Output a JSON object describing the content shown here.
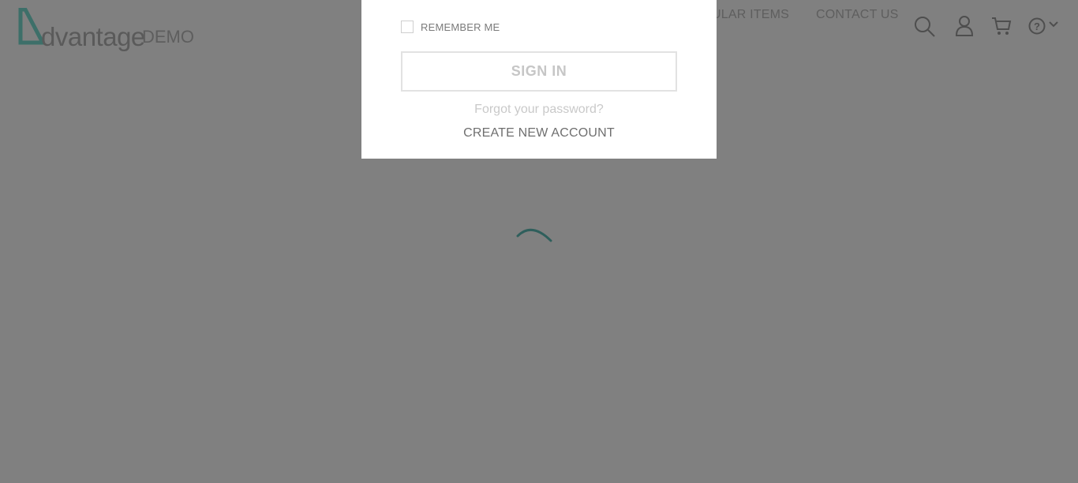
{
  "header": {
    "logo_word": "dvantage",
    "logo_suffix": "DEMO",
    "nav": {
      "popular_items": "POPULAR ITEMS",
      "contact_us": "CONTACT US"
    },
    "icons": [
      "search-icon",
      "user-icon",
      "cart-icon",
      "help-icon",
      "chevron-down-icon"
    ]
  },
  "login_dialog": {
    "remember_me": "REMEMBER ME",
    "remember_checked": false,
    "sign_in": "SIGN IN",
    "forgot_password": "Forgot your password?",
    "create_account": "CREATE NEW ACCOUNT"
  },
  "colors": {
    "overlay": "#808080",
    "brand": "#2e6e6a",
    "dialog_bg": "#ffffff"
  }
}
